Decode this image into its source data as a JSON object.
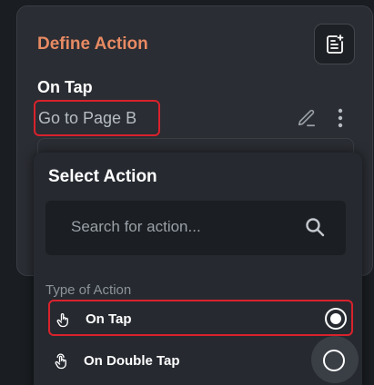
{
  "panel": {
    "title": "Define Action",
    "trigger_heading": "On Tap",
    "action_value": "Go to Page B"
  },
  "dropdown": {
    "title": "Select Action",
    "search": {
      "placeholder": "Search for action..."
    },
    "section_label": "Type of Action",
    "options": [
      {
        "label": "On Tap",
        "selected": true
      },
      {
        "label": "On Double Tap",
        "selected": false
      }
    ]
  },
  "colors": {
    "accent_title": "#e88a63",
    "highlight_border": "#d9222d",
    "panel_bg": "#2a2d33",
    "dropdown_bg": "#262a30"
  },
  "icons": [
    "notes-icon",
    "edit-pencil-icon",
    "more-vertical-icon",
    "search-icon",
    "tap-gesture-icon",
    "double-tap-gesture-icon"
  ]
}
